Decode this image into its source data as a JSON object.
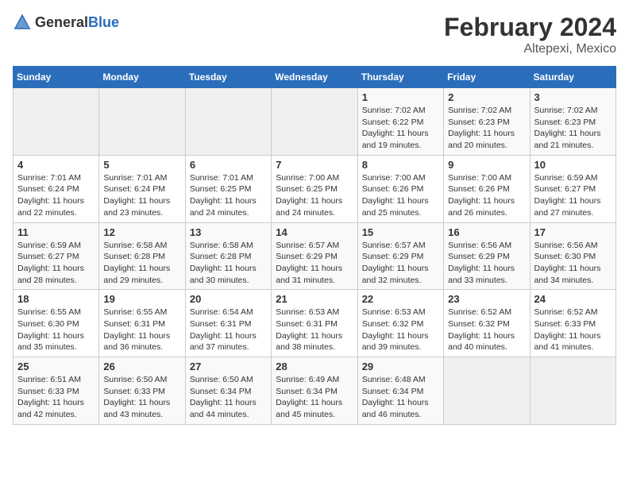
{
  "header": {
    "logo_general": "General",
    "logo_blue": "Blue",
    "month_title": "February 2024",
    "location": "Altepexi, Mexico"
  },
  "weekdays": [
    "Sunday",
    "Monday",
    "Tuesday",
    "Wednesday",
    "Thursday",
    "Friday",
    "Saturday"
  ],
  "weeks": [
    [
      {
        "day": "",
        "info": ""
      },
      {
        "day": "",
        "info": ""
      },
      {
        "day": "",
        "info": ""
      },
      {
        "day": "",
        "info": ""
      },
      {
        "day": "1",
        "info": "Sunrise: 7:02 AM\nSunset: 6:22 PM\nDaylight: 11 hours and 19 minutes."
      },
      {
        "day": "2",
        "info": "Sunrise: 7:02 AM\nSunset: 6:23 PM\nDaylight: 11 hours and 20 minutes."
      },
      {
        "day": "3",
        "info": "Sunrise: 7:02 AM\nSunset: 6:23 PM\nDaylight: 11 hours and 21 minutes."
      }
    ],
    [
      {
        "day": "4",
        "info": "Sunrise: 7:01 AM\nSunset: 6:24 PM\nDaylight: 11 hours and 22 minutes."
      },
      {
        "day": "5",
        "info": "Sunrise: 7:01 AM\nSunset: 6:24 PM\nDaylight: 11 hours and 23 minutes."
      },
      {
        "day": "6",
        "info": "Sunrise: 7:01 AM\nSunset: 6:25 PM\nDaylight: 11 hours and 24 minutes."
      },
      {
        "day": "7",
        "info": "Sunrise: 7:00 AM\nSunset: 6:25 PM\nDaylight: 11 hours and 24 minutes."
      },
      {
        "day": "8",
        "info": "Sunrise: 7:00 AM\nSunset: 6:26 PM\nDaylight: 11 hours and 25 minutes."
      },
      {
        "day": "9",
        "info": "Sunrise: 7:00 AM\nSunset: 6:26 PM\nDaylight: 11 hours and 26 minutes."
      },
      {
        "day": "10",
        "info": "Sunrise: 6:59 AM\nSunset: 6:27 PM\nDaylight: 11 hours and 27 minutes."
      }
    ],
    [
      {
        "day": "11",
        "info": "Sunrise: 6:59 AM\nSunset: 6:27 PM\nDaylight: 11 hours and 28 minutes."
      },
      {
        "day": "12",
        "info": "Sunrise: 6:58 AM\nSunset: 6:28 PM\nDaylight: 11 hours and 29 minutes."
      },
      {
        "day": "13",
        "info": "Sunrise: 6:58 AM\nSunset: 6:28 PM\nDaylight: 11 hours and 30 minutes."
      },
      {
        "day": "14",
        "info": "Sunrise: 6:57 AM\nSunset: 6:29 PM\nDaylight: 11 hours and 31 minutes."
      },
      {
        "day": "15",
        "info": "Sunrise: 6:57 AM\nSunset: 6:29 PM\nDaylight: 11 hours and 32 minutes."
      },
      {
        "day": "16",
        "info": "Sunrise: 6:56 AM\nSunset: 6:29 PM\nDaylight: 11 hours and 33 minutes."
      },
      {
        "day": "17",
        "info": "Sunrise: 6:56 AM\nSunset: 6:30 PM\nDaylight: 11 hours and 34 minutes."
      }
    ],
    [
      {
        "day": "18",
        "info": "Sunrise: 6:55 AM\nSunset: 6:30 PM\nDaylight: 11 hours and 35 minutes."
      },
      {
        "day": "19",
        "info": "Sunrise: 6:55 AM\nSunset: 6:31 PM\nDaylight: 11 hours and 36 minutes."
      },
      {
        "day": "20",
        "info": "Sunrise: 6:54 AM\nSunset: 6:31 PM\nDaylight: 11 hours and 37 minutes."
      },
      {
        "day": "21",
        "info": "Sunrise: 6:53 AM\nSunset: 6:31 PM\nDaylight: 11 hours and 38 minutes."
      },
      {
        "day": "22",
        "info": "Sunrise: 6:53 AM\nSunset: 6:32 PM\nDaylight: 11 hours and 39 minutes."
      },
      {
        "day": "23",
        "info": "Sunrise: 6:52 AM\nSunset: 6:32 PM\nDaylight: 11 hours and 40 minutes."
      },
      {
        "day": "24",
        "info": "Sunrise: 6:52 AM\nSunset: 6:33 PM\nDaylight: 11 hours and 41 minutes."
      }
    ],
    [
      {
        "day": "25",
        "info": "Sunrise: 6:51 AM\nSunset: 6:33 PM\nDaylight: 11 hours and 42 minutes."
      },
      {
        "day": "26",
        "info": "Sunrise: 6:50 AM\nSunset: 6:33 PM\nDaylight: 11 hours and 43 minutes."
      },
      {
        "day": "27",
        "info": "Sunrise: 6:50 AM\nSunset: 6:34 PM\nDaylight: 11 hours and 44 minutes."
      },
      {
        "day": "28",
        "info": "Sunrise: 6:49 AM\nSunset: 6:34 PM\nDaylight: 11 hours and 45 minutes."
      },
      {
        "day": "29",
        "info": "Sunrise: 6:48 AM\nSunset: 6:34 PM\nDaylight: 11 hours and 46 minutes."
      },
      {
        "day": "",
        "info": ""
      },
      {
        "day": "",
        "info": ""
      }
    ]
  ]
}
